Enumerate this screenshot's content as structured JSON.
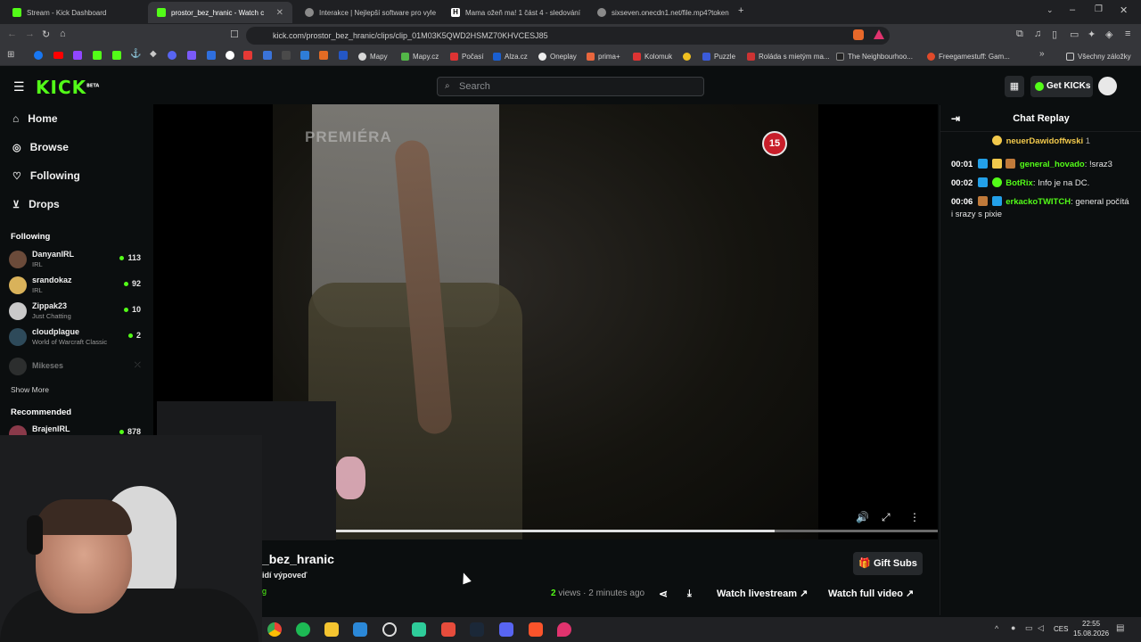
{
  "browser": {
    "tabs": [
      {
        "label": "Stream - Kick Dashboard",
        "color": "#53fc18"
      },
      {
        "label": "prostor_bez_hranic - Watch c",
        "color": "#53fc18",
        "active": true
      },
      {
        "label": "Interakce | Nejlepší software pro vyle",
        "color": "#8a8a8a"
      },
      {
        "label": "Mama ožeň ma! 1 část 4 - sledování",
        "color": "#ffffff"
      },
      {
        "label": "sixseven.onecdn1.net/file.mp4?token",
        "color": "#8a8a8a"
      }
    ],
    "url": "kick.com/prostor_bez_hranic/clips/clip_01M03K5QWD2HSMZ70KHVCESJ85",
    "bookmarks": [
      "Mapy",
      "Mapy.cz",
      "Počasí",
      "Alza.cz",
      "Oneplay",
      "prima+",
      "Kolomuk",
      "Puzzle",
      "Roláda s mietým ma...",
      "The Neighbourhoo...",
      "Freegamestuff: Gam..."
    ],
    "all_bookmarks": "Všechny záložky"
  },
  "header": {
    "logo": "KICK",
    "logo_sup": "BETA",
    "search_placeholder": "Search",
    "get_kicks": "Get KICKs"
  },
  "sidebar": {
    "nav": [
      {
        "label": "Home",
        "icon": "home-icon"
      },
      {
        "label": "Browse",
        "icon": "compass-icon"
      },
      {
        "label": "Following",
        "icon": "heart-icon"
      },
      {
        "label": "Drops",
        "icon": "drops-icon"
      }
    ],
    "following_title": "Following",
    "following": [
      {
        "name": "DanyanIRL",
        "category": "IRL",
        "viewers": "113",
        "color": "#6b4b3a"
      },
      {
        "name": "srandokaz",
        "category": "IRL",
        "viewers": "92",
        "color": "#d9b25a"
      },
      {
        "name": "Zippak23",
        "category": "Just Chatting",
        "viewers": "10",
        "color": "#c9c9c9"
      },
      {
        "name": "cloudplague",
        "category": "World of Warcraft Classic",
        "viewers": "2",
        "color": "#2e4a5a"
      },
      {
        "name": "Mikeses",
        "category": "",
        "viewers": "",
        "color": "#555555"
      }
    ],
    "show_more": "Show More",
    "recommended_title": "Recommended",
    "recommended": [
      {
        "name": "BrajenIRL",
        "viewers": "878",
        "color": "#8a3a4a"
      }
    ]
  },
  "video": {
    "watermark": "PREMIÉRA",
    "rating": "15",
    "progress": 0.73
  },
  "clip": {
    "channel_visible": "_bez_hranic",
    "title_visible": "idí výpoveď",
    "category_visible": "g",
    "views": "2",
    "views_label": "views",
    "time_ago": "· 2 minutes ago",
    "watch_livestream": "Watch livestream",
    "watch_full_video": "Watch full video",
    "gift_subs": "Gift Subs"
  },
  "chat": {
    "title": "Chat Replay",
    "pinned_user": "neuerDawidoffwski",
    "pinned_count": "1",
    "messages": [
      {
        "time": "00:01",
        "user": "general_hovado",
        "text": "!sraz3",
        "color": "#53fc18"
      },
      {
        "time": "00:02",
        "user": "BotRix",
        "text": "Info je na DC.",
        "color": "#53fc18"
      },
      {
        "time": "00:06",
        "user": "erkackoTWITCH",
        "text": "general počítá i srazy s pixie",
        "color": "#53fc18"
      }
    ]
  },
  "taskbar": {
    "time": "22:55",
    "date": "15.08.2026",
    "lang": "CES"
  }
}
